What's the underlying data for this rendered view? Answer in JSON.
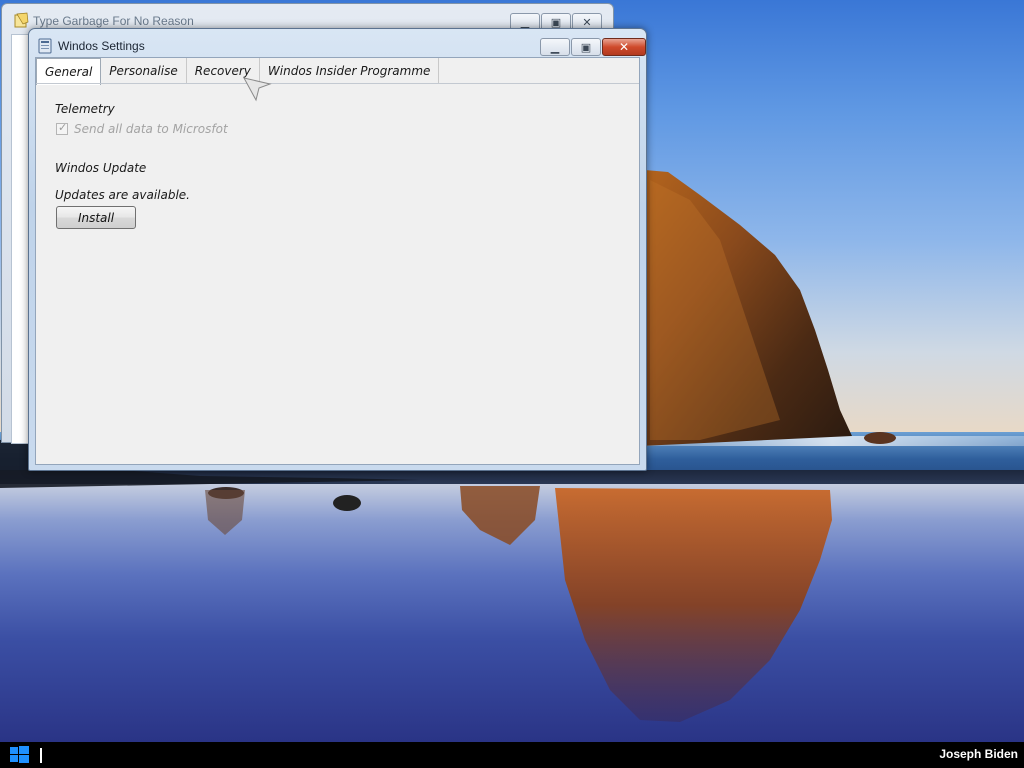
{
  "desktop": {
    "wallpaper": "coastal rock at sunset with reflection on wet sand"
  },
  "back_window": {
    "title": "Type Garbage For No Reason",
    "icon": "notepad-icon",
    "buttons": {
      "minimize": "minimize-icon",
      "maximize": "maximize-icon",
      "close": "close-icon"
    }
  },
  "settings_window": {
    "title": "Windos Settings",
    "icon": "settings-app-icon",
    "tabs": [
      {
        "label": "General",
        "active": true
      },
      {
        "label": "Personalise",
        "active": false
      },
      {
        "label": "Recovery",
        "active": false
      },
      {
        "label": "Windos Insider Programme",
        "active": false
      }
    ],
    "general": {
      "telemetry_heading": "Telemetry",
      "telemetry_checkbox_label": "Send all data to Microsfot",
      "telemetry_checked": true,
      "telemetry_enabled": false,
      "update_heading": "Windos Update",
      "update_status": "Updates are available.",
      "install_button": "Install"
    }
  },
  "taskbar": {
    "start_icon": "windows-logo-icon",
    "user_name": "Joseph Biden"
  },
  "colors": {
    "close_button": "#cf4a2c",
    "taskbar": "#000000",
    "window_frame": "#bfd3ea"
  }
}
